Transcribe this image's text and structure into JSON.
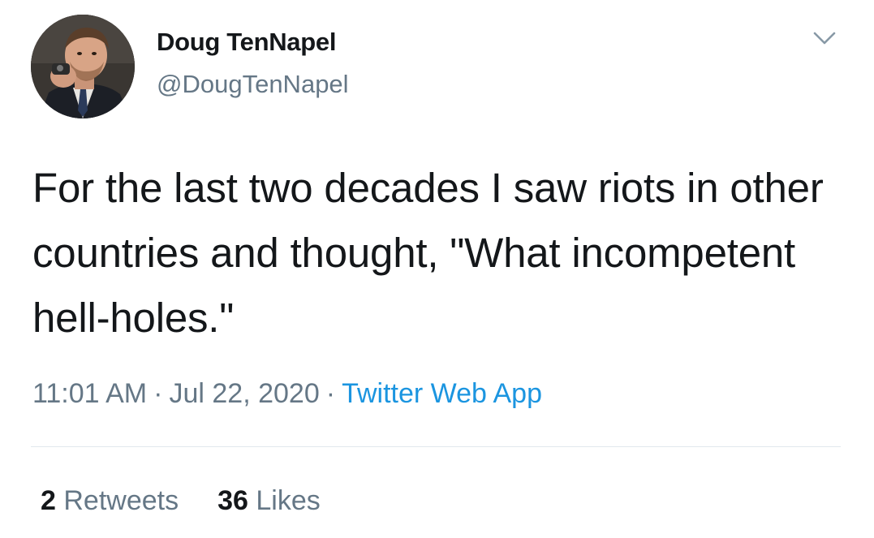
{
  "user": {
    "display_name": "Doug TenNapel",
    "handle": "@DougTenNapel",
    "avatar_icon": "profile-photo",
    "menu_icon": "chevron-down-icon"
  },
  "tweet": {
    "text": "For the last two decades I saw riots in other countries and thought, \"What incompetent hell-holes.\""
  },
  "meta": {
    "time": "11:01 AM",
    "separator": "·",
    "date": "Jul 22, 2020",
    "source": "Twitter Web App"
  },
  "stats": {
    "retweets_count": "2",
    "retweets_label": "Retweets",
    "likes_count": "36",
    "likes_label": "Likes"
  },
  "colors": {
    "text": "#14171a",
    "secondary": "#657786",
    "link": "#1b95e0",
    "divider": "#e1e8ed"
  }
}
